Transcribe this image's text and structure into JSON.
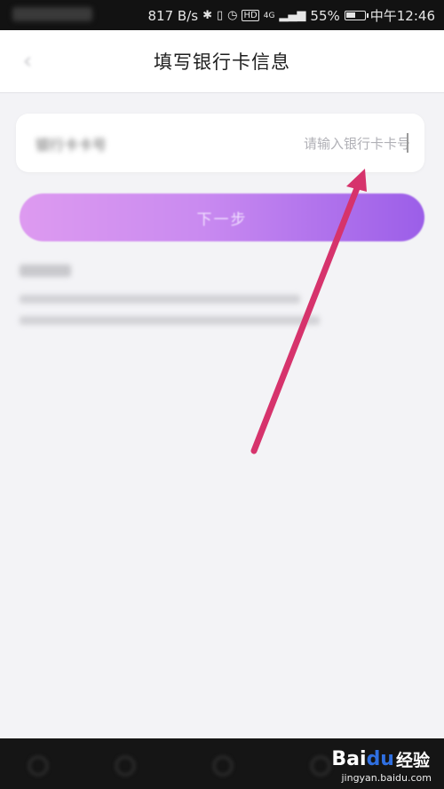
{
  "status_bar": {
    "network_speed": "817 B/s",
    "network_badge": "HD",
    "network_type": "4G",
    "battery": "55%",
    "battery_level": 0.55,
    "time": "中午12:46",
    "icons": [
      "bluetooth-icon",
      "vibrate-icon",
      "alarm-icon",
      "signal-icon",
      "battery-icon"
    ]
  },
  "header": {
    "title": "填写银行卡信息",
    "back_icon": "chevron-left-icon"
  },
  "form": {
    "card_number_placeholder": "请输入银行卡卡号"
  },
  "actions": {
    "next_label": "下一步"
  },
  "annotation": {
    "arrow_color": "#d6336c"
  },
  "watermark": {
    "logo_bai": "Bai",
    "logo_du": "du",
    "label": "经验",
    "url": "jingyan.baidu.com"
  },
  "colors": {
    "accent_start": "#dd9af0",
    "accent_end": "#9b5ee8",
    "page_bg": "#f3f3f6"
  }
}
